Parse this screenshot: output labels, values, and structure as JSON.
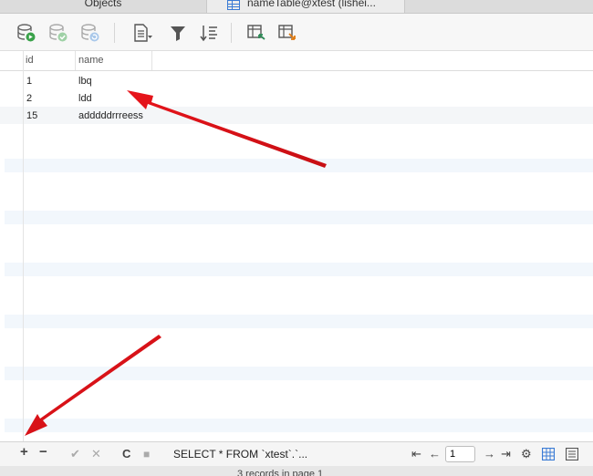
{
  "tabs": [
    {
      "label": "Objects"
    },
    {
      "label": "nameTable@xtest (lishei..."
    }
  ],
  "toolbar": {
    "buttons": [
      "begin-transaction-icon",
      "commit-icon",
      "rollback-icon",
      "text-icon",
      "filter-icon",
      "sort-icon",
      "import-icon",
      "export-icon"
    ]
  },
  "table": {
    "columns": [
      "id",
      "name"
    ],
    "rows": [
      {
        "id": "1",
        "name": "lbq"
      },
      {
        "id": "2",
        "name": "ldd"
      },
      {
        "id": "15",
        "name": "adddddrrreess"
      }
    ]
  },
  "bottom": {
    "add": "+",
    "remove": "−",
    "apply": "✔",
    "discard": "✕",
    "refresh": "C",
    "stop": "■",
    "sql": "SELECT * FROM `xtest`.`...",
    "first": "⇤",
    "prev": "←",
    "page": "1",
    "next": "→",
    "last": "⇥",
    "settings": "⚙"
  },
  "status": {
    "text": "3 records in page 1"
  },
  "colors": {
    "accent": "#3a7bd5",
    "arrow": "#e8141b"
  }
}
